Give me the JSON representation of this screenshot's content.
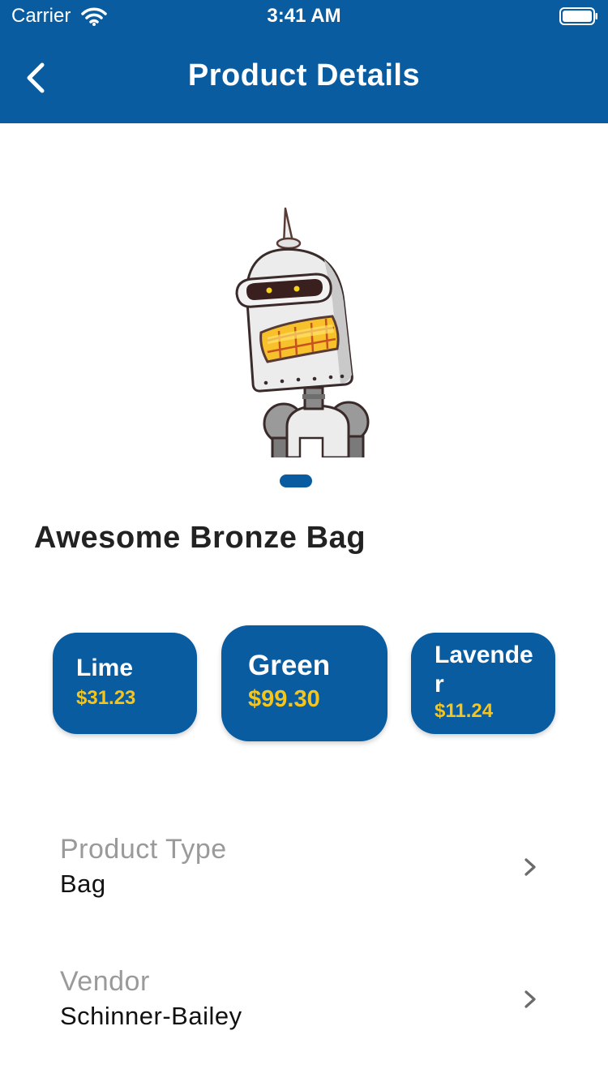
{
  "status_bar": {
    "carrier": "Carrier",
    "time": "3:41 AM",
    "icons": [
      "wifi-icon",
      "battery-icon"
    ]
  },
  "nav": {
    "title": "Product Details",
    "back_icon": "back-chevron-icon"
  },
  "product": {
    "image": "robot-illustration",
    "carousel_pages": 1,
    "name": "Awesome Bronze Bag"
  },
  "variants": [
    {
      "label": "Lime",
      "price": "$31.23",
      "selected": false
    },
    {
      "label": "Green",
      "price": "$99.30",
      "selected": true
    },
    {
      "label": "Lavender",
      "price": "$11.24",
      "selected": false
    }
  ],
  "details": [
    {
      "label": "Product Type",
      "value": "Bag",
      "icon": "chevron-right-icon"
    },
    {
      "label": "Vendor",
      "value": "Schinner-Bailey",
      "icon": "chevron-right-icon"
    }
  ],
  "colors": {
    "primary": "#0a5ca1",
    "price": "#f6c51b",
    "label_gray": "#9a9a9a",
    "text_dark": "#222222"
  }
}
